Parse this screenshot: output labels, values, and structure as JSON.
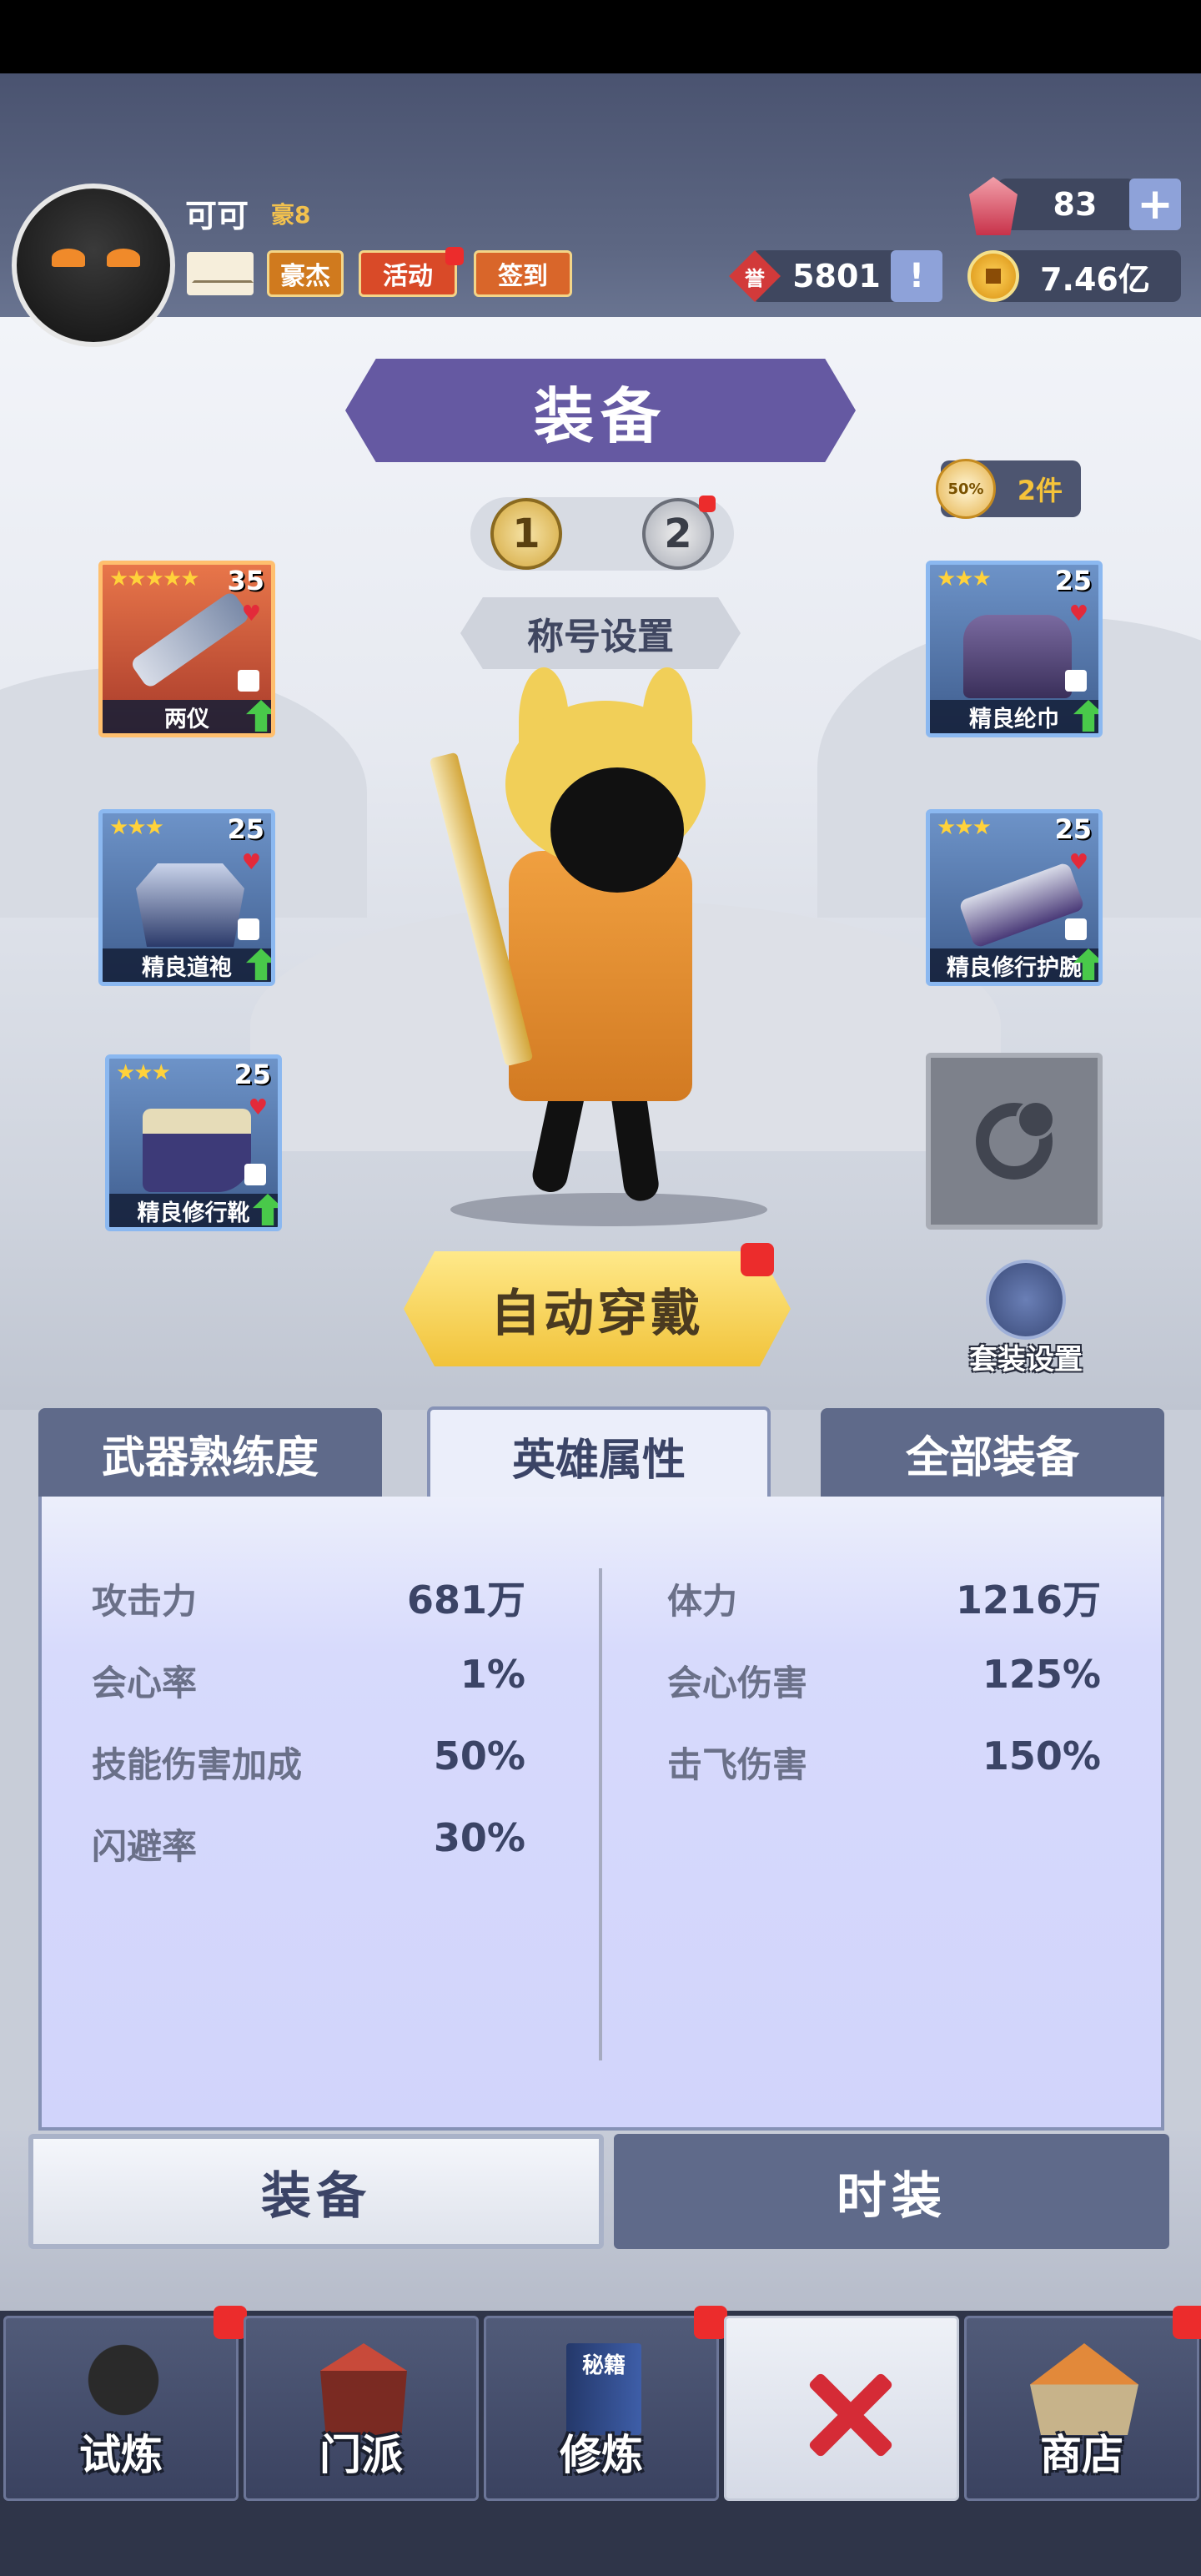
{
  "player": {
    "name": "可可",
    "vip": "豪8"
  },
  "header_buttons": {
    "hero_label": "豪杰",
    "event_label": "活动",
    "signin_label": "签到"
  },
  "resources": {
    "gems": "83",
    "honor": "5801",
    "honor_icon": "誉",
    "gold": "7.46亿"
  },
  "page_title": "装备",
  "loadout_pages": [
    "1",
    "2"
  ],
  "set_count": "2件",
  "set_badge": "50%",
  "title_settings": "称号设置",
  "slots_left": [
    {
      "stars": "★★★★★",
      "level": "35",
      "name": "两仪",
      "rarity": "orange"
    },
    {
      "stars": "★★★",
      "level": "25",
      "name": "精良道袍",
      "rarity": "blue"
    },
    {
      "stars": "★★★",
      "level": "25",
      "name": "精良修行靴",
      "rarity": "blue"
    }
  ],
  "slots_right": [
    {
      "stars": "★★★",
      "level": "25",
      "name": "精良纶巾",
      "rarity": "blue"
    },
    {
      "stars": "★★★",
      "level": "25",
      "name": "精良修行护腕",
      "rarity": "blue"
    }
  ],
  "auto_equip_label": "自动穿戴",
  "suit_settings_label": "套装设置",
  "tabs": [
    "武器熟练度",
    "英雄属性",
    "全部装备"
  ],
  "active_tab": "英雄属性",
  "stats_left": [
    {
      "key": "攻击力",
      "value": "681万"
    },
    {
      "key": "会心率",
      "value": "1%"
    },
    {
      "key": "技能伤害加成",
      "value": "50%"
    },
    {
      "key": "闪避率",
      "value": "30%"
    }
  ],
  "stats_right": [
    {
      "key": "体力",
      "value": "1216万"
    },
    {
      "key": "会心伤害",
      "value": "125%"
    },
    {
      "key": "击飞伤害",
      "value": "150%"
    }
  ],
  "bottom_tabs": [
    "装备",
    "时装"
  ],
  "nav": [
    {
      "label": "试炼",
      "icon": "ninja-icon"
    },
    {
      "label": "门派",
      "icon": "temple-icon"
    },
    {
      "label": "修炼",
      "icon": "book-icon",
      "book_text": "秘籍"
    },
    {
      "label": "",
      "icon": "close-icon"
    },
    {
      "label": "商店",
      "icon": "shop-icon"
    }
  ],
  "colors": {
    "accent_purple": "#6559a2",
    "panel": "#d1d4fb",
    "tab_inactive": "#5f6a8a",
    "red_dot": "#ec2c2c",
    "upgrade_green": "#49c94a"
  }
}
